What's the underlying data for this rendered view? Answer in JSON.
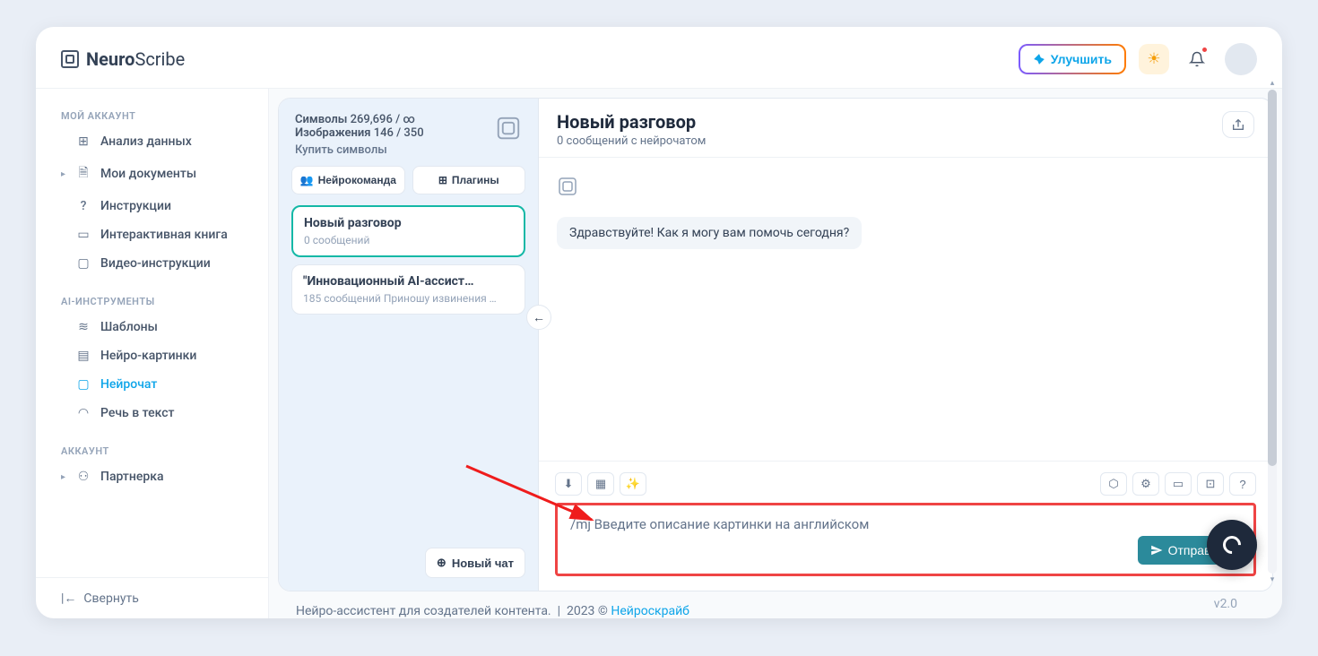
{
  "brand": {
    "name_bold": "Neuro",
    "name_thin": "Scribe"
  },
  "top": {
    "improve_label": "Улучшить"
  },
  "sidebar": {
    "section1_title": "МОЙ АККАУНТ",
    "items1": [
      {
        "label": "Анализ данных"
      },
      {
        "label": "Мои документы"
      },
      {
        "label": "Инструкции"
      },
      {
        "label": "Интерактивная книга"
      },
      {
        "label": "Видео-инструкции"
      }
    ],
    "section2_title": "AI-ИНСТРУМЕНТЫ",
    "items2": [
      {
        "label": "Шаблоны"
      },
      {
        "label": "Нейро-картинки"
      },
      {
        "label": "Нейрочат"
      },
      {
        "label": "Речь в текст"
      }
    ],
    "section3_title": "АККАУНТ",
    "items3": [
      {
        "label": "Партнерка"
      }
    ],
    "collapse_label": "Свернуть"
  },
  "stats": {
    "symbols_label": "Символы",
    "symbols_value": "269,696 / ∞",
    "images_label": "Изображения",
    "images_value": "146 / 350",
    "buy_label": "Купить символы"
  },
  "tabs": {
    "team_label": "Нейрокоманда",
    "plugins_label": "Плагины"
  },
  "conversations": [
    {
      "title": "Новый разговор",
      "sub": "0 сообщений"
    },
    {
      "title": "\"Инновационный AI-ассист…",
      "sub": "185 сообщений Приношу извинения …"
    }
  ],
  "newchat_label": "Новый чат",
  "chat": {
    "title": "Новый разговор",
    "subtitle": "0 сообщений с нейрочатом",
    "greeting": "Здравствуйте! Как я могу вам помочь сегодня?"
  },
  "input": {
    "placeholder": "/mj Введите описание картинки на английском",
    "send_label": "Отправить"
  },
  "footer": {
    "text": "Нейро-ассистент для создателей контента.",
    "year": "2023 ©",
    "brand": "Нейроскрайб",
    "version": "v2.0"
  }
}
